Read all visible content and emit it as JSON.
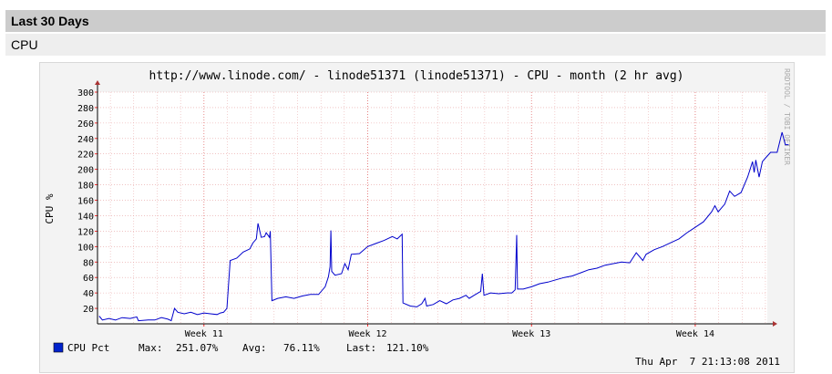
{
  "section": {
    "title": "Last 30 Days",
    "subtitle": "CPU"
  },
  "chart_data": {
    "type": "line",
    "title": "http://www.linode.com/ - linode51371 (linode51371) - CPU - month (2 hr avg)",
    "watermark": "RRDTOOL / TOBI OETIKER",
    "ylabel": "CPU %",
    "xlabel": "",
    "ylim": [
      0,
      300
    ],
    "yticks": [
      20,
      40,
      60,
      80,
      100,
      120,
      140,
      160,
      180,
      200,
      220,
      240,
      260,
      280,
      300
    ],
    "x_tick_labels": [
      "Week 11",
      "Week 12",
      "Week 13",
      "Week 14"
    ],
    "x_tick_positions_weeks": [
      11,
      12,
      13,
      14
    ],
    "xlim_weeks": [
      10.35,
      14.44
    ],
    "grid": true,
    "line_color": "#0000cc",
    "series": [
      {
        "name": "CPU Pct",
        "color": "#0000cc",
        "points": [
          [
            10.36,
            10
          ],
          [
            10.38,
            5
          ],
          [
            10.42,
            7
          ],
          [
            10.46,
            5
          ],
          [
            10.5,
            8
          ],
          [
            10.55,
            7
          ],
          [
            10.59,
            9
          ],
          [
            10.6,
            4
          ],
          [
            10.66,
            5
          ],
          [
            10.7,
            5
          ],
          [
            10.74,
            8
          ],
          [
            10.78,
            6
          ],
          [
            10.8,
            4
          ],
          [
            10.82,
            20
          ],
          [
            10.84,
            15
          ],
          [
            10.88,
            13
          ],
          [
            10.92,
            15
          ],
          [
            10.96,
            12
          ],
          [
            11.0,
            14
          ],
          [
            11.04,
            13
          ],
          [
            11.08,
            12
          ],
          [
            11.1,
            14
          ],
          [
            11.12,
            15
          ],
          [
            11.14,
            20
          ],
          [
            11.16,
            82
          ],
          [
            11.2,
            85
          ],
          [
            11.24,
            93
          ],
          [
            11.28,
            97
          ],
          [
            11.3,
            105
          ],
          [
            11.32,
            110
          ],
          [
            11.33,
            130
          ],
          [
            11.35,
            112
          ],
          [
            11.37,
            113
          ],
          [
            11.38,
            118
          ],
          [
            11.4,
            112
          ],
          [
            11.405,
            120
          ],
          [
            11.415,
            30
          ],
          [
            11.45,
            33
          ],
          [
            11.5,
            35
          ],
          [
            11.55,
            33
          ],
          [
            11.6,
            36
          ],
          [
            11.65,
            38
          ],
          [
            11.7,
            38
          ],
          [
            11.74,
            48
          ],
          [
            11.76,
            61
          ],
          [
            11.77,
            74
          ],
          [
            11.775,
            121
          ],
          [
            11.78,
            68
          ],
          [
            11.8,
            63
          ],
          [
            11.84,
            65
          ],
          [
            11.86,
            78
          ],
          [
            11.88,
            70
          ],
          [
            11.9,
            90
          ],
          [
            11.95,
            91
          ],
          [
            12.0,
            100
          ],
          [
            12.05,
            104
          ],
          [
            12.1,
            108
          ],
          [
            12.15,
            113
          ],
          [
            12.18,
            110
          ],
          [
            12.21,
            116
          ],
          [
            12.215,
            27
          ],
          [
            12.26,
            23
          ],
          [
            12.3,
            22
          ],
          [
            12.33,
            26
          ],
          [
            12.35,
            33
          ],
          [
            12.36,
            23
          ],
          [
            12.4,
            25
          ],
          [
            12.44,
            30
          ],
          [
            12.48,
            26
          ],
          [
            12.52,
            31
          ],
          [
            12.56,
            33
          ],
          [
            12.6,
            37
          ],
          [
            12.62,
            33
          ],
          [
            12.65,
            37
          ],
          [
            12.69,
            42
          ],
          [
            12.7,
            65
          ],
          [
            12.71,
            37
          ],
          [
            12.75,
            40
          ],
          [
            12.8,
            39
          ],
          [
            12.85,
            40
          ],
          [
            12.88,
            40
          ],
          [
            12.9,
            44
          ],
          [
            12.91,
            115
          ],
          [
            12.915,
            45
          ],
          [
            12.95,
            45
          ],
          [
            13.0,
            48
          ],
          [
            13.05,
            52
          ],
          [
            13.1,
            54
          ],
          [
            13.15,
            57
          ],
          [
            13.2,
            60
          ],
          [
            13.25,
            62
          ],
          [
            13.3,
            66
          ],
          [
            13.35,
            70
          ],
          [
            13.4,
            72
          ],
          [
            13.45,
            76
          ],
          [
            13.5,
            78
          ],
          [
            13.55,
            80
          ],
          [
            13.6,
            79
          ],
          [
            13.64,
            92
          ],
          [
            13.68,
            82
          ],
          [
            13.7,
            90
          ],
          [
            13.75,
            96
          ],
          [
            13.8,
            100
          ],
          [
            13.85,
            105
          ],
          [
            13.9,
            110
          ],
          [
            13.95,
            118
          ],
          [
            14.0,
            125
          ],
          [
            14.05,
            132
          ],
          [
            14.1,
            145
          ],
          [
            14.12,
            153
          ],
          [
            14.14,
            145
          ],
          [
            14.18,
            155
          ],
          [
            14.21,
            172
          ],
          [
            14.24,
            165
          ],
          [
            14.28,
            170
          ],
          [
            14.32,
            190
          ],
          [
            14.35,
            210
          ],
          [
            14.36,
            196
          ],
          [
            14.37,
            212
          ],
          [
            14.39,
            190
          ],
          [
            14.41,
            210
          ],
          [
            14.43,
            215
          ],
          [
            14.46,
            222
          ],
          [
            14.5,
            222
          ],
          [
            14.53,
            248
          ],
          [
            14.55,
            232
          ],
          [
            14.57,
            232
          ]
        ]
      }
    ],
    "legend": {
      "series_label": "CPU Pct",
      "max_label": "Max:",
      "max_value": "251.07%",
      "avg_label": "Avg:",
      "avg_value": "76.11%",
      "last_label": "Last:",
      "last_value": "121.10%"
    },
    "timestamp": "Thu Apr  7 21:13:08 2011"
  }
}
